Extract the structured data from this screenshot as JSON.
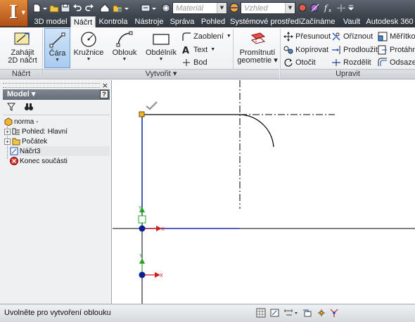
{
  "quick_access": {
    "material_placeholder": "Materiál",
    "appearance_placeholder": "Vzhled"
  },
  "tabs": [
    {
      "label": "3D model"
    },
    {
      "label": "Náčrt"
    },
    {
      "label": "Kontrola"
    },
    {
      "label": "Nástroje"
    },
    {
      "label": "Správa"
    },
    {
      "label": "Pohled"
    },
    {
      "label": "Systémové prostředí"
    },
    {
      "label": "Začínáme"
    },
    {
      "label": "Vault"
    },
    {
      "label": "Autodesk 360"
    }
  ],
  "active_tab": "Náčrt",
  "ribbon": {
    "sketch_panel": {
      "title": "Náčrt",
      "start_sketch": {
        "line1": "Zahájit",
        "line2": "2D náčrt"
      }
    },
    "create_panel": {
      "title": "Vytvořit",
      "line": "Čára",
      "circle": "Kružnice",
      "arc": "Oblouk",
      "rectangle": "Obdélník",
      "fillet": "Zaoblení",
      "text": "Text",
      "point": "Bod",
      "project": {
        "line1": "Promítnutí",
        "line2": "geometrie"
      }
    },
    "modify_panel": {
      "title": "Upravit",
      "move": "Přesunout",
      "copy": "Kopírovat",
      "rotate": "Otočit",
      "trim": "Oříznout",
      "extend": "Prodloužit",
      "split": "Rozdělit",
      "scale": "Měřítko",
      "stretch": "Protáhno",
      "offset": "Odsazen"
    }
  },
  "browser": {
    "title": "Model",
    "help": "?",
    "tree": [
      {
        "label": "norma -"
      },
      {
        "label": "Pohled: Hlavní"
      },
      {
        "label": "Počátek"
      },
      {
        "label": "Náčrt3"
      },
      {
        "label": "Konec součásti"
      }
    ]
  },
  "canvas": {
    "x_axis_label": "X",
    "y_axis_label": "Y"
  },
  "status": {
    "message": "Uvolněte pro vytvoření oblouku"
  },
  "colors": {
    "active_tab_bg": "#f3f4f6",
    "sketch_line": "#000000",
    "constrained_line": "#1a2fa8",
    "origin_point": "#0a1f8f",
    "axis_x_arrow": "#d11f1f",
    "axis_y_arrow": "#2aa02a"
  }
}
